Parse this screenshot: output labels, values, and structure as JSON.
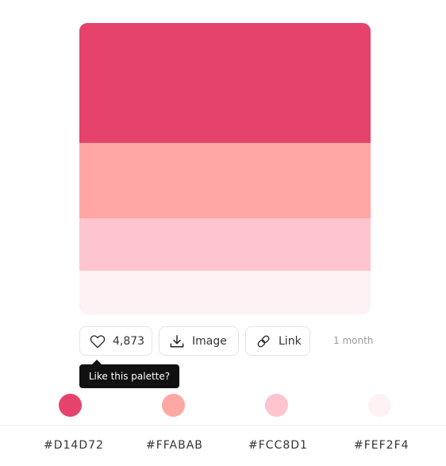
{
  "palette": {
    "colors": [
      "#D14D72",
      "#FFABAB",
      "#FCC8D1",
      "#FEF2F4"
    ],
    "swatch_render": [
      "#E6436C",
      "#FFA7A4",
      "#FEC5CE",
      "#FEF2F4"
    ]
  },
  "actions": {
    "likes": "4,873",
    "image_label": "Image",
    "link_label": "Link",
    "age": "1 month",
    "like_icon": "heart-icon",
    "image_icon": "download-icon",
    "link_icon": "link-icon"
  },
  "tooltip": {
    "text": "Like this palette?"
  },
  "codes": {
    "c1": "#D14D72",
    "c2": "#FFABAB",
    "c3": "#FCC8D1",
    "c4": "#FEF2F4"
  }
}
